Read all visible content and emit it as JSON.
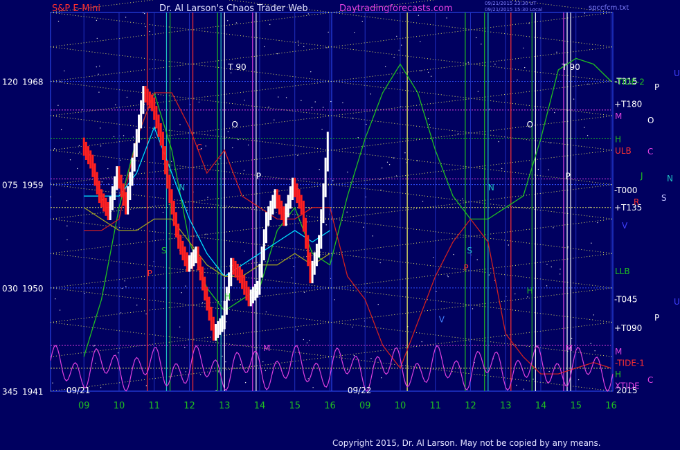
{
  "header": {
    "symbol": "S&P E-Mini",
    "title": "Dr. Al Larson's Chaos Trader Web",
    "site": "Daytradingforecasts.com",
    "stamp1": "09/21/2015 23:30 UT",
    "stamp2": "09/21/2015 15:30 Local",
    "file": "spccfcm.txt"
  },
  "footer": {
    "copyright": "Copyright 2015, Dr. Al Larson. May not be copied by any means."
  },
  "colors": {
    "background": "#000060",
    "price_up": "#ffffff",
    "price_down": "#ff2020",
    "ma_fast": "#00e0ff",
    "ma_mid": "#20c020",
    "ma_slow": "#d02020",
    "oscillator": "#e040e0",
    "grid_dotted": "#e0e060"
  },
  "chart_data": {
    "type": "line",
    "title": "S&P E-Mini",
    "y_ticks": [
      {
        "deg": "120",
        "price": "1968"
      },
      {
        "deg": "075",
        "price": "1959"
      },
      {
        "deg": "030",
        "price": "1950"
      },
      {
        "deg": "345",
        "price": "1941"
      }
    ],
    "ylim": [
      1941,
      1974
    ],
    "x_ticks": [
      "09",
      "10",
      "11",
      "12",
      "13",
      "14",
      "15",
      "16",
      "09",
      "10",
      "11",
      "12",
      "13",
      "14",
      "15",
      "16"
    ],
    "session_labels": [
      "09/21",
      "09/22"
    ],
    "year_label": "2015",
    "price_series": {
      "name": "S&P E-Mini",
      "x": [
        9,
        9.25,
        9.5,
        9.75,
        10,
        10.25,
        10.5,
        10.75,
        11,
        11.25,
        11.5,
        11.75,
        12,
        12.25,
        12.5,
        12.75,
        13,
        13.25,
        13.5,
        13.75,
        14,
        14.25,
        14.5,
        14.75,
        15,
        15.25,
        15.5,
        15.75,
        16
      ],
      "y": [
        1962.5,
        1961,
        1958,
        1956.5,
        1960,
        1957,
        1962,
        1967,
        1966,
        1963,
        1958,
        1954,
        1952,
        1953,
        1949.5,
        1946,
        1947,
        1952,
        1951,
        1949,
        1950,
        1956,
        1958,
        1956,
        1959,
        1957,
        1951,
        1954,
        1963
      ]
    },
    "forecast_lines": [
      {
        "name": "green",
        "x": [
          9,
          9.5,
          10,
          10.5,
          11,
          11.5,
          12,
          12.5,
          13,
          13.5,
          14,
          14.5,
          15,
          15.5,
          16,
          16.5,
          17,
          17.5,
          18,
          18.5,
          19,
          19.5,
          20,
          20.5,
          21,
          21.5,
          22,
          22.5,
          23,
          23.5,
          24
        ],
        "y": [
          1944,
          1949,
          1957,
          1963,
          1967,
          1962,
          1954,
          1950,
          1948,
          1949,
          1950,
          1955,
          1957,
          1953,
          1952,
          1958,
          1963,
          1967,
          1969.5,
          1967,
          1962,
          1958,
          1956,
          1956,
          1957,
          1958,
          1963,
          1969,
          1970,
          1969.5,
          1968
        ]
      },
      {
        "name": "red",
        "x": [
          9,
          9.5,
          10,
          10.5,
          11,
          11.5,
          12,
          12.5,
          13,
          13.5,
          14,
          14.5,
          15,
          15.5,
          16,
          16.5,
          17,
          17.5,
          18,
          18.5,
          19,
          19.5,
          20,
          20.5,
          21,
          21.5,
          22,
          22.5,
          23,
          23.5,
          24
        ],
        "y": [
          1955,
          1955,
          1956,
          1963,
          1967,
          1967,
          1964,
          1960,
          1962,
          1958,
          1957,
          1956,
          1956,
          1957,
          1957,
          1951,
          1949,
          1945,
          1943,
          1947,
          1951,
          1954,
          1956,
          1954,
          1946,
          1944,
          1942.5,
          1942.5,
          1943,
          1943.5,
          1943
        ]
      },
      {
        "name": "cyan",
        "x": [
          9,
          9.5,
          10,
          10.5,
          11,
          11.5,
          12,
          12.5,
          13,
          13.5,
          14,
          14.5,
          15,
          15.5,
          16
        ],
        "y": [
          1958,
          1958,
          1958,
          1960,
          1964,
          1960,
          1956,
          1953,
          1951,
          1952,
          1953,
          1954,
          1955,
          1954,
          1955
        ]
      },
      {
        "name": "olive",
        "x": [
          9,
          9.5,
          10,
          10.5,
          11,
          11.5,
          12,
          12.5,
          13,
          13.5,
          14,
          14.5,
          15,
          15.5,
          16
        ],
        "y": [
          1957,
          1956,
          1955,
          1955,
          1956,
          1956,
          1954,
          1952,
          1951,
          1951,
          1952,
          1952,
          1953,
          1952,
          1953
        ]
      }
    ],
    "left_labels": [
      {
        "text": "S",
        "x": 11.2,
        "y": 1953,
        "color": "#20c020"
      },
      {
        "text": "N",
        "x": 11.7,
        "y": 1958.5,
        "color": "#20c0c0"
      },
      {
        "text": "C",
        "x": 12.2,
        "y": 1962,
        "color": "#ff3030"
      },
      {
        "text": "O",
        "x": 13.2,
        "y": 1964,
        "color": "#ffffff"
      },
      {
        "text": "P",
        "x": 13.9,
        "y": 1959.5,
        "color": "#ffffff"
      },
      {
        "text": "T  90",
        "x": 13.1,
        "y": 1969,
        "color": "#ffffff"
      },
      {
        "text": "M",
        "x": 14.1,
        "y": 1944.5,
        "color": "#e040e0"
      },
      {
        "text": "P",
        "x": 10.8,
        "y": 1951,
        "color": "#ff3030"
      },
      {
        "text": "H",
        "x": 13.0,
        "y": 1949,
        "color": "#20c020"
      }
    ],
    "right_labels": [
      {
        "text": "S",
        "x": 19.9,
        "y": 1953,
        "color": "#20c0c0"
      },
      {
        "text": "N",
        "x": 20.5,
        "y": 1958.5,
        "color": "#20c0c0"
      },
      {
        "text": "O",
        "x": 21.6,
        "y": 1964,
        "color": "#ffffff"
      },
      {
        "text": "P",
        "x": 22.7,
        "y": 1959.5,
        "color": "#ffffff"
      },
      {
        "text": "T  90",
        "x": 22.6,
        "y": 1969,
        "color": "#ffffff"
      },
      {
        "text": "P",
        "x": 19.8,
        "y": 1951.5,
        "color": "#ff3030"
      },
      {
        "text": "H",
        "x": 21.6,
        "y": 1949.5,
        "color": "#20c020"
      },
      {
        "text": "M",
        "x": 22.7,
        "y": 1944.5,
        "color": "#e040e0"
      },
      {
        "text": "V",
        "x": 19.1,
        "y": 1947,
        "color": "#4080ff"
      }
    ],
    "level_labels": [
      {
        "text": "-T315",
        "y": 1968
      },
      {
        "text": "+T180",
        "y": 1966
      },
      {
        "text": "-T000",
        "y": 1958.5
      },
      {
        "text": "+T135",
        "y": 1957
      },
      {
        "text": "-T045",
        "y": 1949
      },
      {
        "text": "+T090",
        "y": 1946.5
      }
    ],
    "side_labels": [
      {
        "text": "-TIDE-2",
        "y": 1968,
        "color": "#20c020"
      },
      {
        "text": "M",
        "y": 1965,
        "color": "#e040e0"
      },
      {
        "text": "H",
        "y": 1963,
        "color": "#20c020"
      },
      {
        "text": "ULB",
        "y": 1962,
        "color": "#ff3030"
      },
      {
        "text": "LLB",
        "y": 1951.5,
        "color": "#20c020"
      },
      {
        "text": "M",
        "y": 1944.5,
        "color": "#e040e0"
      },
      {
        "text": "-TIDE-1",
        "y": 1943.5,
        "color": "#ff3030"
      },
      {
        "text": "H",
        "y": 1942.5,
        "color": "#20c020"
      },
      {
        "text": "XTIDE",
        "y": 1941.5,
        "color": "#e040e0"
      }
    ],
    "planet_column": [
      {
        "text": "U",
        "color": "#4040ff"
      },
      {
        "text": "P",
        "color": "#ffffff"
      },
      {
        "text": "O",
        "color": "#ffffff"
      },
      {
        "text": "C",
        "color": "#e040e0"
      },
      {
        "text": "J",
        "color": "#20c020"
      },
      {
        "text": "N",
        "color": "#20c0c0"
      },
      {
        "text": "S",
        "color": "#c0c0ff"
      },
      {
        "text": "R",
        "color": "#ff3030"
      },
      {
        "text": "V",
        "color": "#4040ff"
      },
      {
        "text": "U",
        "color": "#4040ff"
      },
      {
        "text": "P",
        "color": "#ffffff"
      },
      {
        "text": "C",
        "color": "#e040e0"
      }
    ]
  }
}
